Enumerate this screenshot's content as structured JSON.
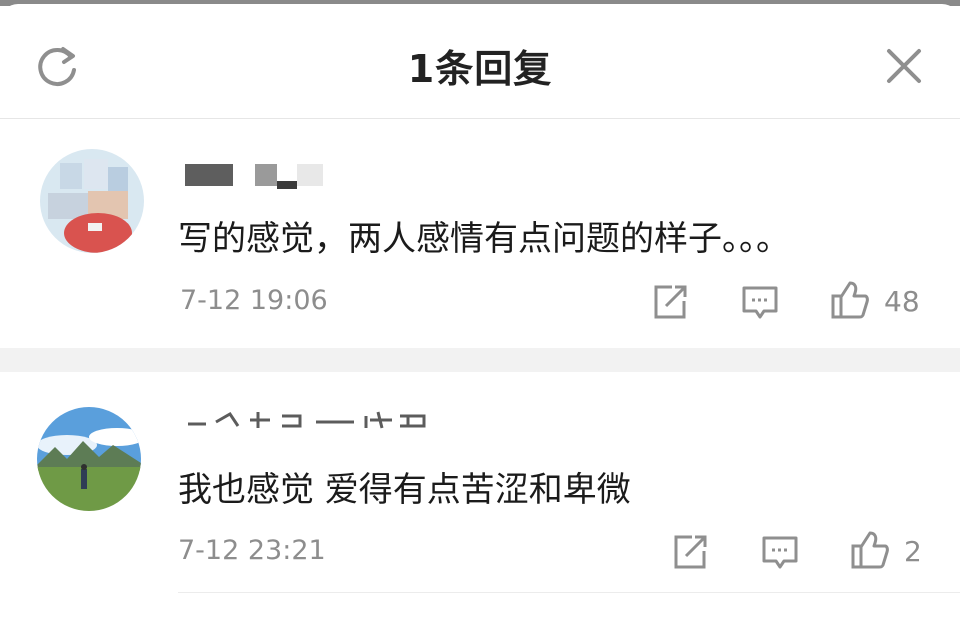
{
  "header": {
    "title": "1条回复",
    "refresh_icon": "refresh-icon",
    "close_icon": "close-icon"
  },
  "comments": [
    {
      "username": "",
      "text": "写的感觉，两人感情有点问题的样子。。。",
      "time": "7-12 19:06",
      "likes": "48",
      "actions": [
        "share-icon",
        "reply-icon",
        "like-icon"
      ]
    },
    {
      "username": "",
      "text": "我也感觉 爱得有点苦涩和卑微",
      "time": "7-12 23:21",
      "likes": "2",
      "actions": [
        "share-icon",
        "reply-icon",
        "like-icon"
      ]
    }
  ],
  "colors": {
    "text_primary": "#1b1b1b",
    "text_secondary": "#8d8d8d",
    "icon_gray": "#8f8f8f",
    "divider": "#e6e6e6",
    "band": "#f2f2f2"
  }
}
